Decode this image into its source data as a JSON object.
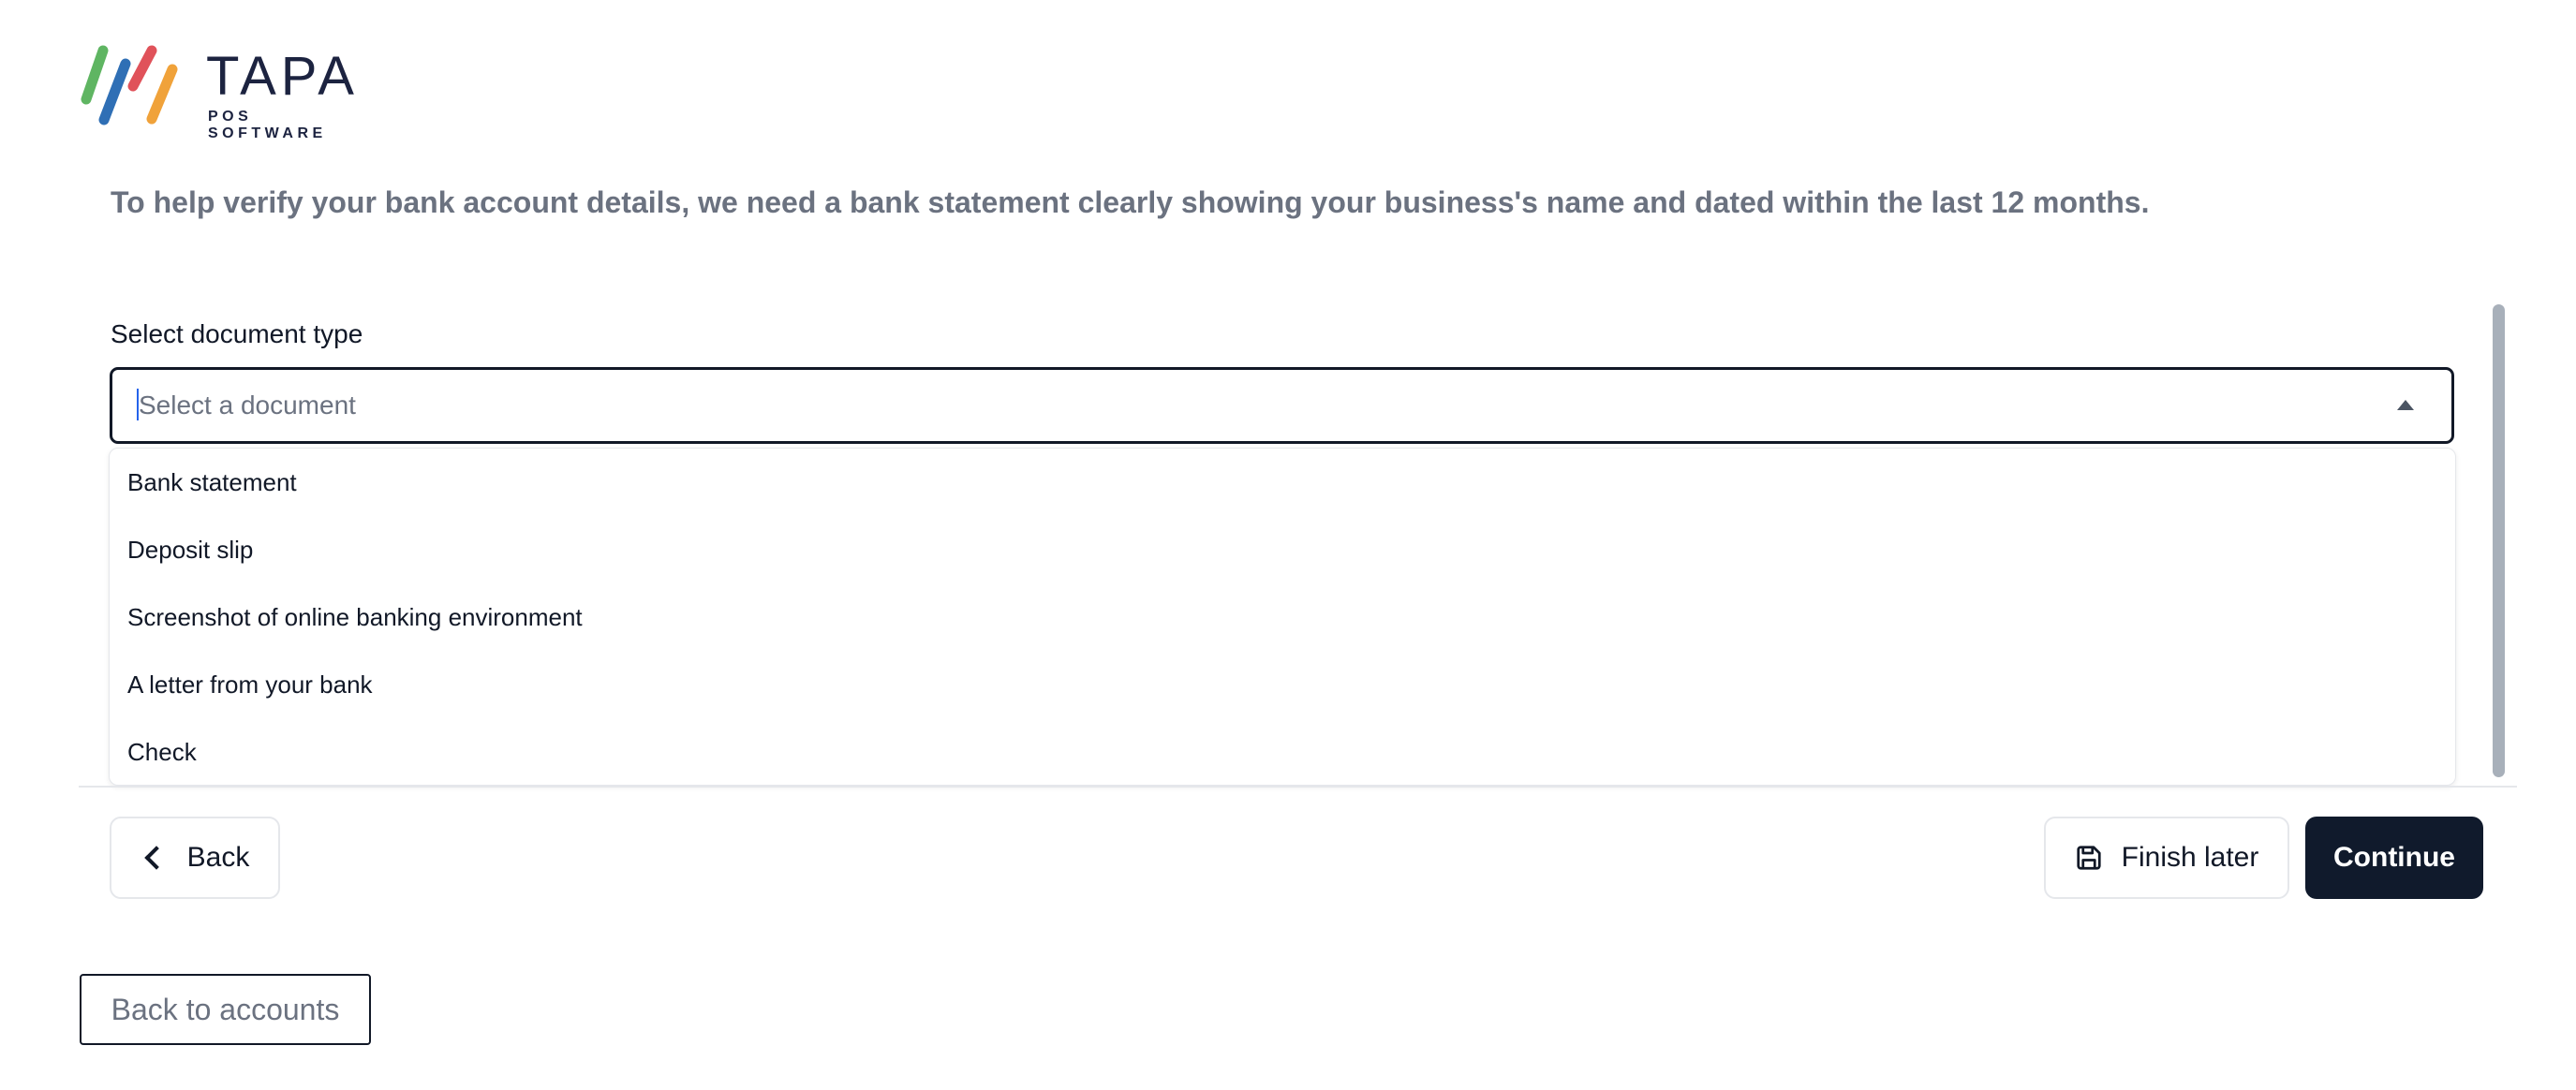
{
  "brand": {
    "name": "TAPA",
    "tagline": "POS SOFTWARE",
    "stripe_colors": [
      "#5fb562",
      "#2f6fb5",
      "#e0525a",
      "#f0a23a"
    ]
  },
  "intro_text": "To help verify your bank account details, we need a bank statement clearly showing your business's name and dated within the last 12 months.",
  "document_select": {
    "label": "Select document type",
    "placeholder": "Select a document",
    "expanded": true,
    "options": [
      "Bank statement",
      "Deposit slip",
      "Screenshot of online banking environment",
      "A letter from your bank",
      "Check"
    ]
  },
  "footer_actions": {
    "back_label": "Back",
    "finish_later_label": "Finish later",
    "continue_label": "Continue"
  },
  "back_to_accounts_label": "Back to accounts",
  "icons": {
    "back": "chevron-left-icon",
    "finish_later": "save-icon",
    "select": "caret-up-icon"
  },
  "colors": {
    "primary_button": "#101a2c",
    "text_muted": "#6b7280",
    "border_focus": "#111827"
  }
}
